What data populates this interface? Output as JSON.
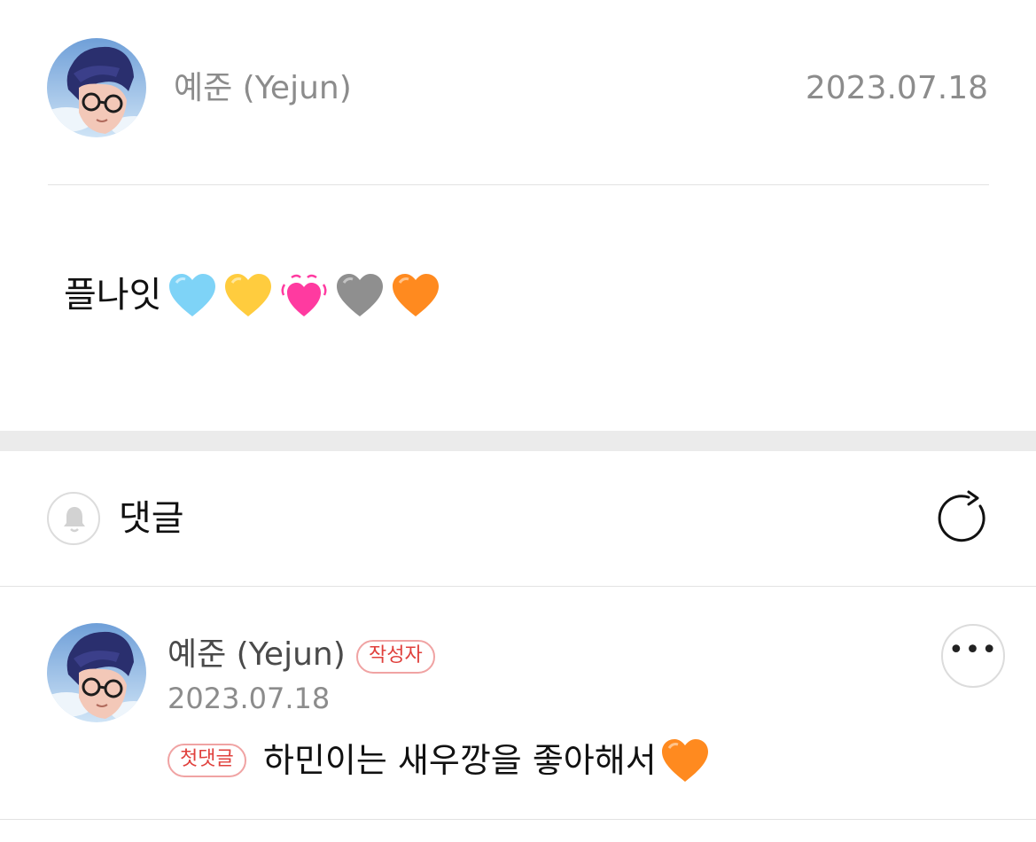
{
  "post": {
    "author": "예준 (Yejun)",
    "date": "2023.07.18",
    "text": "플나잇",
    "hearts": [
      {
        "icon": "light-blue-heart-icon",
        "color": "#7ed3f7"
      },
      {
        "icon": "yellow-heart-icon",
        "color": "#ffcc3e"
      },
      {
        "icon": "beating-heart-icon",
        "color": "#ff3aa0"
      },
      {
        "icon": "grey-heart-icon",
        "color": "#8f8f8f"
      },
      {
        "icon": "orange-heart-icon",
        "color": "#ff8a1f"
      }
    ]
  },
  "comments_header": {
    "title": "댓글",
    "bell_icon": "bell-icon",
    "refresh_icon": "refresh-icon"
  },
  "comment": {
    "author": "예준 (Yejun)",
    "author_badge": "작성자",
    "date": "2023.07.18",
    "first_badge": "첫댓글",
    "text": "하민이는 새우깡을 좋아해서",
    "heart": {
      "icon": "orange-heart-icon",
      "color": "#ff8a1f"
    },
    "more_label": "•••"
  },
  "colors": {
    "accent_red": "#e0403c",
    "muted_text": "#8c8c8c",
    "divider": "#e2e2e2",
    "section_gap": "#ebebeb"
  }
}
